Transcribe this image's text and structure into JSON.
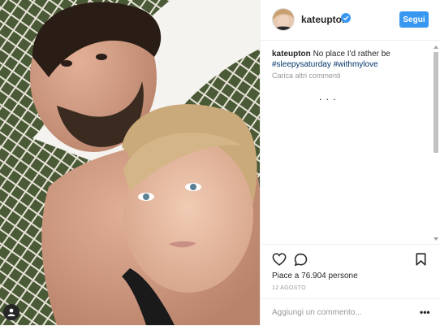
{
  "post": {
    "photo": {
      "alt_icon": "photo-content"
    },
    "tag_badge_icon": "person-tag-icon"
  },
  "header": {
    "username": "kateupton",
    "verified_icon": "verified-badge-icon",
    "follow_label": "Segui"
  },
  "caption": {
    "username": "kateupton",
    "text": "No place I'd rather be",
    "hashtags": [
      "#sleepysaturday",
      "#withmylove"
    ]
  },
  "comments": {
    "load_more": "Carica altri commenti",
    "loading_indicator": ". . ."
  },
  "actions": {
    "like_icon": "heart-icon",
    "comment_icon": "comment-icon",
    "save_icon": "bookmark-icon",
    "likes_text": "Piace a 76.904 persone",
    "date": "12 AGOSTO"
  },
  "comment_box": {
    "placeholder": "Aggiungi un commento...",
    "more_label": "•••"
  },
  "colors": {
    "accent": "#3897f0",
    "hashtag": "#003569",
    "muted": "#999999",
    "border": "#efefef"
  }
}
